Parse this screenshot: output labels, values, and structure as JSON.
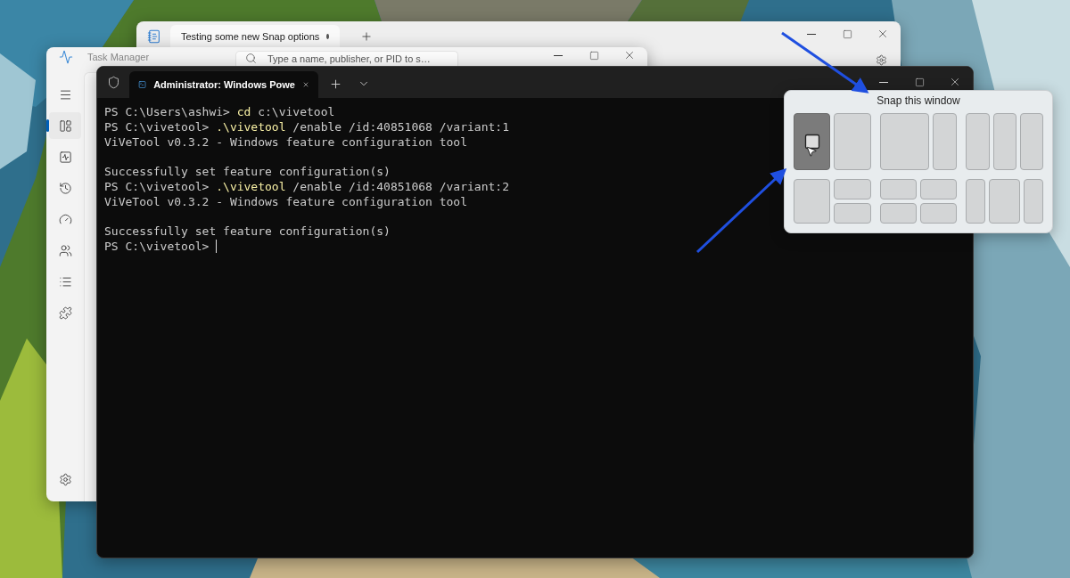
{
  "notepad_window": {
    "tab_title": "Testing some new Snap options",
    "tab_modified": true
  },
  "task_manager": {
    "title": "Task Manager",
    "search": {
      "placeholder": "Type a name, publisher, or PID to s…"
    },
    "nav_items": [
      {
        "kind": "menu",
        "selected": false
      },
      {
        "kind": "apps",
        "selected": true
      },
      {
        "kind": "performance",
        "selected": false
      },
      {
        "kind": "history",
        "selected": false
      },
      {
        "kind": "startup",
        "selected": false
      },
      {
        "kind": "users",
        "selected": false
      },
      {
        "kind": "details",
        "selected": false
      },
      {
        "kind": "services",
        "selected": false
      }
    ],
    "settings_item": {
      "kind": "settings",
      "selected": false
    }
  },
  "terminal": {
    "tab_title": "Administrator: Windows Powe",
    "lines": [
      {
        "kind": "command",
        "prompt": "PS C:\\Users\\ashwi>",
        "command": "cd",
        "args": "c:\\vivetool"
      },
      {
        "kind": "command",
        "prompt": "PS C:\\vivetool>",
        "command": ".\\vivetool",
        "args": "/enable /id:40851068 /variant:1"
      },
      {
        "kind": "output",
        "text": "ViVeTool v0.3.2 - Windows feature configuration tool"
      },
      {
        "kind": "blank"
      },
      {
        "kind": "output",
        "text": "Successfully set feature configuration(s)"
      },
      {
        "kind": "command",
        "prompt": "PS C:\\vivetool>",
        "command": ".\\vivetool",
        "args": "/enable /id:40851068 /variant:2"
      },
      {
        "kind": "output",
        "text": "ViVeTool v0.3.2 - Windows feature configuration tool"
      },
      {
        "kind": "blank"
      },
      {
        "kind": "output",
        "text": "Successfully set feature configuration(s)"
      },
      {
        "kind": "prompt",
        "prompt": "PS C:\\vivetool>",
        "cursor": true
      }
    ]
  },
  "snap_flyout": {
    "title": "Snap this window",
    "layouts": [
      {
        "kind": "halves",
        "zones": [
          {
            "selected": true
          },
          {
            "selected": false
          }
        ]
      },
      {
        "kind": "two-thirds",
        "zones": [
          {
            "selected": false
          },
          {
            "selected": false
          }
        ]
      },
      {
        "kind": "thirds",
        "zones": [
          {
            "selected": false
          },
          {
            "selected": false
          },
          {
            "selected": false
          }
        ]
      },
      {
        "kind": "half-stack",
        "zones": [
          {
            "selected": false
          },
          {
            "selected": false
          },
          {
            "selected": false
          }
        ]
      },
      {
        "kind": "quarters",
        "zones": [
          {
            "selected": false
          },
          {
            "selected": false
          },
          {
            "selected": false
          },
          {
            "selected": false
          }
        ]
      },
      {
        "kind": "wide-center",
        "zones": [
          {
            "selected": false
          },
          {
            "selected": false
          },
          {
            "selected": false
          }
        ]
      }
    ]
  }
}
